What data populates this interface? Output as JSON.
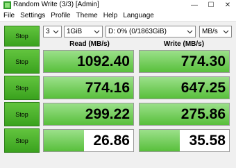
{
  "window": {
    "title": "Random Write (3/3) [Admin]",
    "controls": {
      "minimize": "—",
      "maximize": "☐",
      "close": "✕"
    }
  },
  "menu": [
    "File",
    "Settings",
    "Profile",
    "Theme",
    "Help",
    "Language"
  ],
  "toolbar": {
    "all_button": "Stop",
    "count": "3",
    "size": "1GiB",
    "drive": "D: 0% (0/1863GiB)",
    "unit": "MB/s"
  },
  "headers": {
    "read": "Read (MB/s)",
    "write": "Write (MB/s)"
  },
  "rows": [
    {
      "button": "Stop",
      "read": "1092.40",
      "write": "774.30",
      "read_fill": 1.0,
      "write_fill": 1.0
    },
    {
      "button": "Stop",
      "read": "774.16",
      "write": "647.25",
      "read_fill": 1.0,
      "write_fill": 1.0
    },
    {
      "button": "Stop",
      "read": "299.22",
      "write": "275.86",
      "read_fill": 1.0,
      "write_fill": 1.0
    },
    {
      "button": "Stop",
      "read": "26.86",
      "write": "35.58",
      "read_fill": 0.45,
      "write_fill": 0.45
    }
  ],
  "colors": {
    "button_green": "#3aa21e",
    "bar_green": "#58bf3b"
  }
}
